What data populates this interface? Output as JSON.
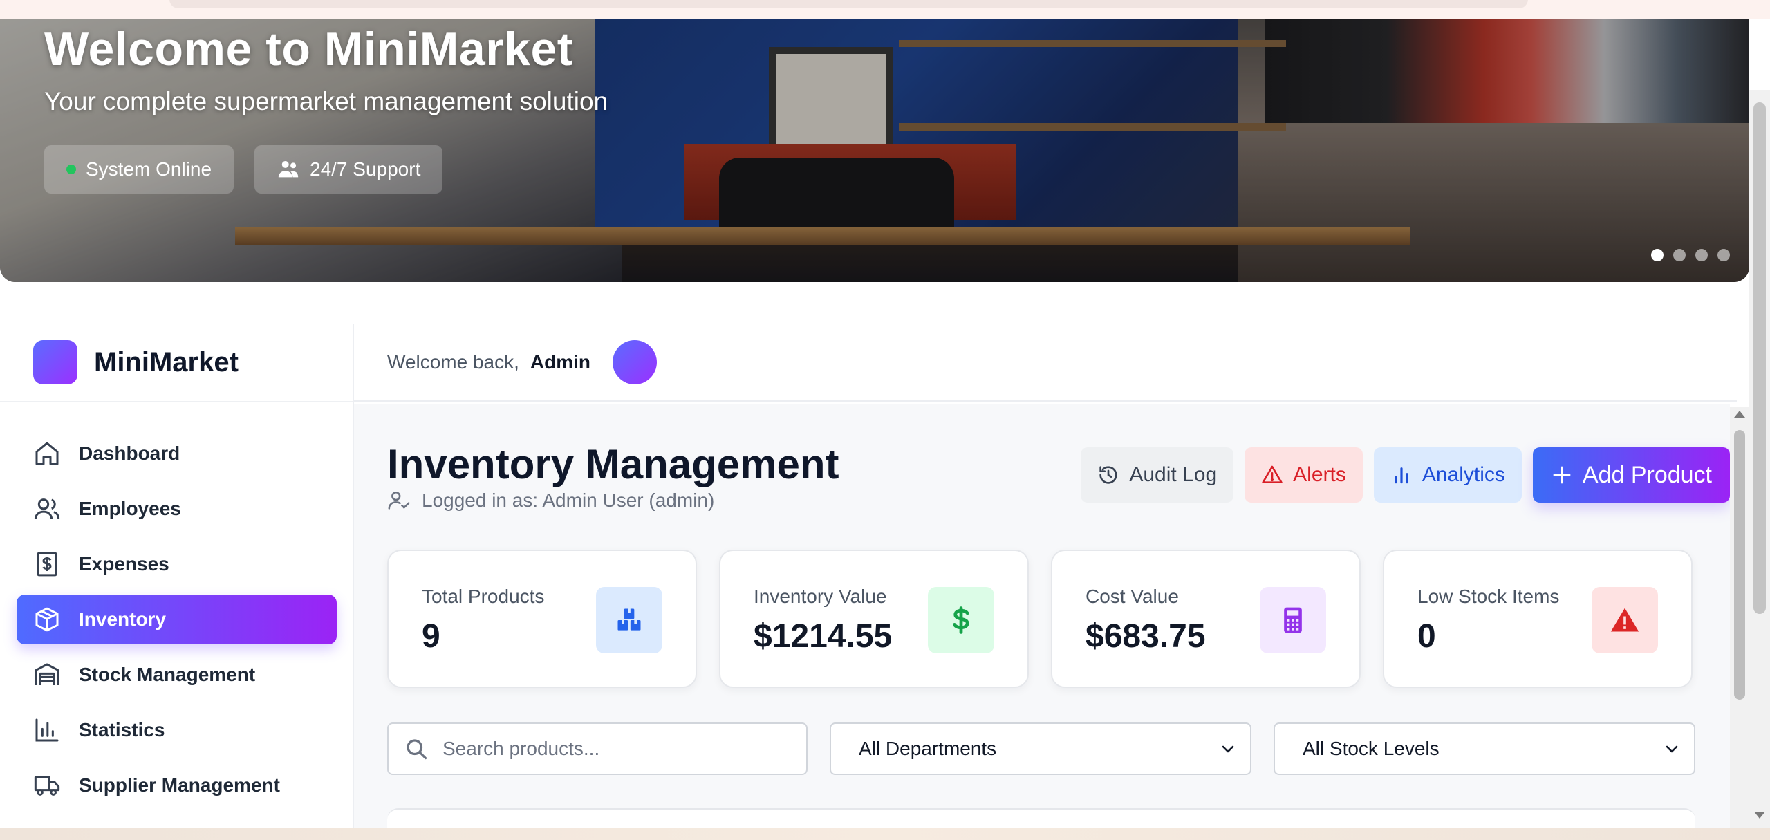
{
  "hero": {
    "title": "Welcome to MiniMarket",
    "subtitle": "Your complete supermarket management solution",
    "chips": [
      {
        "label": "System Online",
        "icon": "status-dot-icon",
        "color": "#22c55e"
      },
      {
        "label": "24/7 Support",
        "icon": "users-icon"
      }
    ],
    "carousel": {
      "slides": 4,
      "active": 1
    }
  },
  "brand": {
    "name": "MiniMarket"
  },
  "sidebar": {
    "items": [
      {
        "label": "Dashboard",
        "icon": "home-icon",
        "active": false
      },
      {
        "label": "Employees",
        "icon": "users-icon",
        "active": false
      },
      {
        "label": "Expenses",
        "icon": "receipt-icon",
        "active": false
      },
      {
        "label": "Inventory",
        "icon": "box-icon",
        "active": true
      },
      {
        "label": "Stock Management",
        "icon": "warehouse-icon",
        "active": false
      },
      {
        "label": "Statistics",
        "icon": "bar-chart-icon",
        "active": false
      },
      {
        "label": "Supplier Management",
        "icon": "truck-icon",
        "active": false
      }
    ]
  },
  "topbar": {
    "welcome_text": "Welcome back,",
    "user": "Admin"
  },
  "page": {
    "title": "Inventory Management",
    "logged_in": "Logged in as: Admin User (admin)"
  },
  "actions": {
    "audit_log": "Audit Log",
    "alerts": "Alerts",
    "analytics": "Analytics",
    "add_product": "Add Product"
  },
  "stats": [
    {
      "label": "Total Products",
      "value": "9",
      "icon": "boxes-icon",
      "color": "#2563eb"
    },
    {
      "label": "Inventory Value",
      "value": "$1214.55",
      "icon": "dollar-icon",
      "color": "#16a34a"
    },
    {
      "label": "Cost Value",
      "value": "$683.75",
      "icon": "calculator-icon",
      "color": "#9333ea"
    },
    {
      "label": "Low Stock Items",
      "value": "0",
      "icon": "warning-icon",
      "color": "#dc2626"
    }
  ],
  "filters": {
    "search_placeholder": "Search products...",
    "department": "All Departments",
    "stock_level": "All Stock Levels"
  },
  "colors": {
    "accent_start": "#4f6bff",
    "accent_end": "#9b23f5"
  }
}
